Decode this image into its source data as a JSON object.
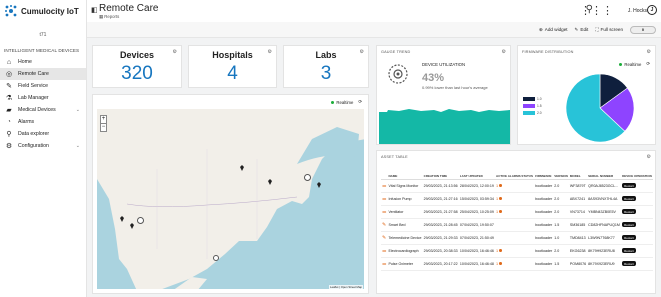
{
  "brand": {
    "name": "Cumulocity IoT"
  },
  "tenant": "t71",
  "nav_group": "INTELLIGENT MEDICAL DEVICES",
  "nav": [
    {
      "label": "Home",
      "icon": "home-icon",
      "glyph": "⌂"
    },
    {
      "label": "Remote Care",
      "icon": "globe-icon",
      "glyph": "◎"
    },
    {
      "label": "Field Service",
      "icon": "wrench-icon",
      "glyph": "✎"
    },
    {
      "label": "Lab Manager",
      "icon": "flask-icon",
      "glyph": "⚗"
    },
    {
      "label": "Medical Devices",
      "icon": "folder-icon",
      "glyph": "▰"
    },
    {
      "label": "Alarms",
      "icon": "bell-icon",
      "glyph": "🔔"
    },
    {
      "label": "Data explorer",
      "icon": "data-explorer-icon",
      "glyph": "⚲"
    },
    {
      "label": "Configuration",
      "icon": "cog-icon",
      "glyph": "⚙"
    }
  ],
  "page": {
    "title": "Remote Care",
    "subtitle": "Reports"
  },
  "user": {
    "name": "J. Hocks",
    "initial": "J"
  },
  "actions": {
    "add_widget": "Add widget",
    "edit": "Edit",
    "full_screen": "Full screen",
    "toggle": "0"
  },
  "stats": [
    {
      "label": "Devices",
      "value": "320"
    },
    {
      "label": "Hospitals",
      "value": "4"
    },
    {
      "label": "Labs",
      "value": "3"
    }
  ],
  "map": {
    "realtime": "Realtime",
    "zoom_in": "+",
    "zoom_out": "−",
    "attribution": "Leaflet | Open Street Map"
  },
  "util": {
    "card_title": "GAUGE TREND",
    "title": "DEVICE UTILIZATION",
    "value": "43%",
    "subtitle": "0.99% lower than last hour's average"
  },
  "pie": {
    "card_title": "FIRMWARE DISTRIBUTION",
    "realtime": "Realtime",
    "legend": [
      {
        "label": "1.0",
        "color": "#0f1f3d"
      },
      {
        "label": "1.5",
        "color": "#8e44ff"
      },
      {
        "label": "2.0",
        "color": "#28c3d8"
      }
    ],
    "chart_data": {
      "type": "pie",
      "categories": [
        "1.0",
        "1.5",
        "2.0"
      ],
      "values": [
        15,
        22,
        63
      ]
    }
  },
  "assets": {
    "card_title": "ASSET TABLE",
    "columns": [
      "NAME",
      "CREATION TIME",
      "LAST UPDATED",
      "ACTIVE ALARMS STATUS",
      "FIRMWARE",
      "VERSION",
      "MODEL",
      "SERIAL NUMBER",
      "DEVICE OPERATION"
    ],
    "rows": [
      {
        "name": "Vital Signs Monitor",
        "created": "29/03/2023, 21:13:56",
        "updated": "28/04/2023, 12:00:19",
        "alarms": "1",
        "firmware": "bootloader",
        "version": "2.0",
        "model": "WF3879T",
        "serial": "QR0AJ8523GCL...",
        "op": "Restart"
      },
      {
        "name": "Infusion Pump",
        "created": "29/03/2023, 21:27:16",
        "updated": "15/04/2023, 03:59:34",
        "alarms": "1",
        "firmware": "bootloader",
        "version": "2.0",
        "model": "ABX7241",
        "serial": "8AS93VNX7HL4A",
        "op": "Restart"
      },
      {
        "name": "Ventilator",
        "created": "29/03/2023, 21:27:58",
        "updated": "25/04/2023, 10:25:09",
        "alarms": "1",
        "firmware": "bootloader",
        "version": "2.0",
        "model": "VN73714",
        "serial": "YMBN43ZB0E5V",
        "op": "Restart"
      },
      {
        "name": "Smart Bed",
        "created": "29/03/2023, 21:28:45",
        "updated": "07/04/2023, 19:50:07",
        "alarms": "",
        "firmware": "bootloader",
        "version": "1.5",
        "model": "SM36185",
        "serial": "CD82HFNAPUQ1M",
        "op": "Restart"
      },
      {
        "name": "Telemedicine Device",
        "created": "29/03/2023, 21:29:33",
        "updated": "07/04/2023, 21:50:49",
        "alarms": "",
        "firmware": "bootloader",
        "version": "1.0",
        "model": "TMD8413",
        "serial": "L3W9N7T68K77",
        "op": "Restart"
      },
      {
        "name": "Electrocardiograph",
        "created": "29/03/2023, 20:38:33",
        "updated": "10/04/2023, 16:46:46",
        "alarms": "1",
        "firmware": "bootloader",
        "version": "2.0",
        "model": "EKG6238",
        "serial": "8K79H923ERU8",
        "op": "Restart"
      },
      {
        "name": "Pulse Oximeter",
        "created": "29/03/2023, 20:17:22",
        "updated": "10/04/2023, 16:46:48",
        "alarms": "1",
        "firmware": "bootloader",
        "version": "1.5",
        "model": "POM8076",
        "serial": "8K79X923ERU9",
        "op": "Restart"
      }
    ]
  },
  "colors": {
    "accent": "#1776bf",
    "alarm": "#e06a1b",
    "realtime": "#1bad3a",
    "sparkline": "#14b8a6"
  }
}
